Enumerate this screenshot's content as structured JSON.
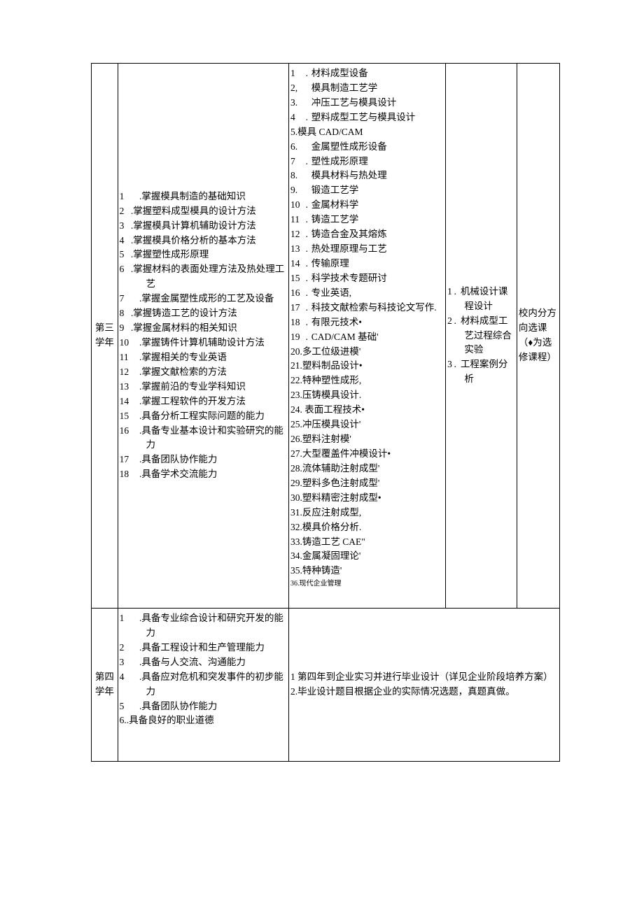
{
  "rows": [
    {
      "year": "第三学年",
      "abilities": [
        ".掌握模具制造的基础知识",
        ".掌握塑料成型模具的设计方法",
        ".掌握模具计算机辅助设计方法",
        ".掌握模具价格分析的基本方法",
        ".掌握塑性成形原理",
        ".掌握材料的表面处理方法及热处理工艺",
        ".掌握金属塑性成形的工艺及设备",
        ".掌握铸造工艺的设计方法",
        ".掌握金属材料的相关知识",
        ".掌握铸件计算机辅助设计方法",
        ".掌握相关的专业英语",
        ".掌握文献检索的方法",
        ".掌握前沿的专业学科知识",
        ".掌握工程软件的开发方法",
        ".具备分析工程实际问题的能力",
        ".具备专业基本设计和实验研究的能力",
        ".具备团队协作能力",
        ".具备学术交流能力"
      ],
      "courses": [
        "材料成型设备",
        "模具制造工艺学",
        "冲压工艺与模具设计",
        "塑料成型工艺与模具设计",
        "模具 CAD/CAM",
        "金属塑性成形设备",
        "塑性成形原理",
        "模具材料与热处理",
        "锻造工艺学",
        "金属材料学",
        "铸造工艺学",
        "铸造合金及其熔炼",
        "热处理原理与工艺",
        "传输原理",
        "科学技术专题研讨",
        "专业英语,",
        "科技文献检索与科技论文写作.",
        "有限元技术•",
        "CAD/CAM 基础'",
        "多工位级进模'",
        "塑料制品设计•",
        "特种塑性成形,",
        "压铸模具设计.",
        "表面工程技术•",
        "冲压模具设计'",
        "塑料注射模'",
        "大型覆盖件冲模设计•",
        "流体辅助注射成型'",
        "塑料多色注射成型'",
        "塑料精密注射成型•",
        "反应注射成型,",
        "模具价格分析.",
        "铸造工艺 CAE\"",
        "金属凝固理论'",
        "特种铸造'",
        "现代企业管理"
      ],
      "practice": [
        "机械设计课程设计",
        "材料成型工艺过程综合实验",
        "工程案例分析"
      ],
      "note": "校内分方向选课\n（♦为选修课程）"
    },
    {
      "year": "第四学年",
      "abilities": [
        ".具备专业综合设计和研究开发的能力",
        ".具备工程设计和生产管理能力",
        ".具备与人交流、沟通能力",
        ".具备应对危机和突发事件的初步能力",
        ".具备团队协作能力",
        ".具备良好的职业道德"
      ],
      "merged_text": [
        "1 第四年到企业实习并进行毕业设计（详见企业阶段培养方案）",
        "2.毕业设计题目根据企业的实际情况选题，真题真做。"
      ]
    }
  ]
}
